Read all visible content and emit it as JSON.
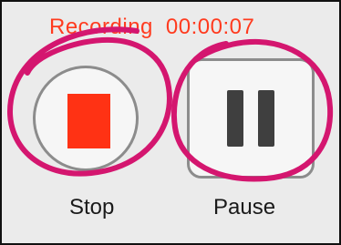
{
  "recorder": {
    "status_label": "Recording",
    "elapsed_time": "00:00:07",
    "stop_label": "Stop",
    "pause_label": "Pause"
  },
  "colors": {
    "recording_red": "#ff3214",
    "annotation_magenta": "#d4166f"
  },
  "icons": {
    "stop": "stop-square-icon",
    "pause": "pause-bars-icon"
  }
}
